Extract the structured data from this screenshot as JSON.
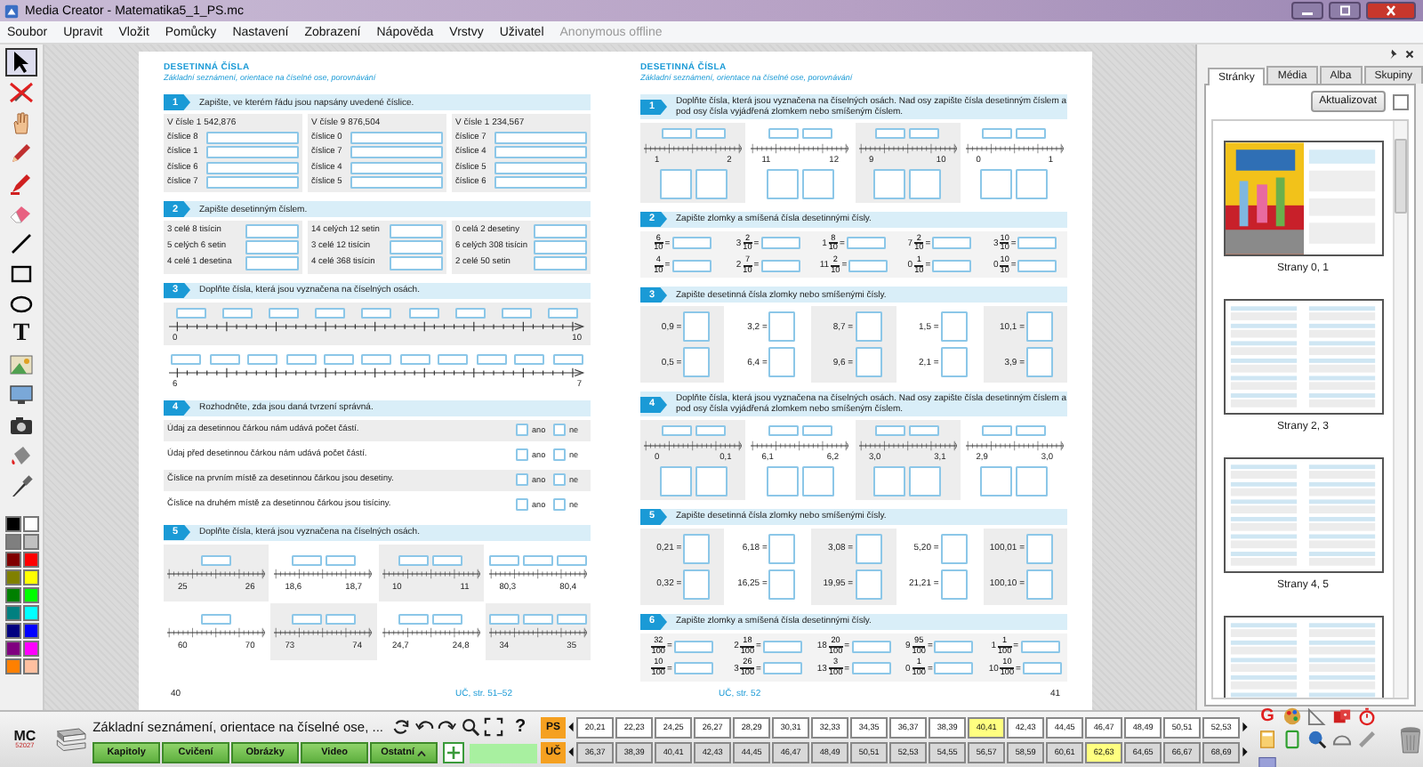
{
  "window": {
    "title": "Media Creator - Matematika5_1_PS.mc"
  },
  "menu": {
    "items": [
      "Soubor",
      "Upravit",
      "Vložit",
      "Pomůcky",
      "Nastavení",
      "Zobrazení",
      "Nápověda",
      "Vrstvy",
      "Uživatel"
    ],
    "user_status": "Anonymous offline"
  },
  "toolbar": {
    "text_tool": "T"
  },
  "pages": [
    {
      "section": "DESETINNÁ ČÍSLA",
      "subtitle": "Základní seznámení, orientace na číselné ose, porovnávání",
      "exercises": [
        {
          "number": "1",
          "kind": "digits",
          "instruction": "Zapište, ve kterém řádu jsou napsány uvedené číslice.",
          "columns": [
            {
              "heading": "V čísle 1 542,876",
              "labels": [
                "číslice 8",
                "číslice 1",
                "číslice 6",
                "číslice 7"
              ]
            },
            {
              "heading": "V čísle 9 876,504",
              "labels": [
                "číslice 0",
                "číslice 7",
                "číslice 4",
                "číslice 5"
              ]
            },
            {
              "heading": "V čísle 1 234,567",
              "labels": [
                "číslice 7",
                "číslice 4",
                "číslice 5",
                "číslice 6"
              ]
            }
          ]
        },
        {
          "number": "2",
          "kind": "words",
          "instruction": "Zapište desetinným číslem.",
          "columns": [
            [
              "3 celé 8 tisícin",
              "5 celých 6 setin",
              "4 celé 1 desetina"
            ],
            [
              "14 celých 12 setin",
              "3 celé 12 tisícin",
              "4 celé 368 tisícin"
            ],
            [
              "0 celá 2 desetiny",
              "6 celých 308 tisícin",
              "2 celé 50 setin"
            ]
          ]
        },
        {
          "number": "3",
          "kind": "axis",
          "instruction": "Doplňte čísla, která jsou vyznačena na číselných osách.",
          "axes": [
            {
              "start": "0",
              "end": "10"
            },
            {
              "start": "6",
              "end": "7"
            }
          ]
        },
        {
          "number": "4",
          "kind": "statements",
          "instruction": "Rozhodněte, zda jsou daná tvrzení správná.",
          "rows": [
            {
              "text": "Údaj za desetinnou čárkou nám udává počet částí.",
              "yes": "ano",
              "yes_checked": false,
              "no": "ne",
              "no_checked": false
            },
            {
              "text": "Údaj před desetinnou čárkou nám udává počet částí.",
              "yes": "ano",
              "yes_checked": false,
              "no": "ne",
              "no_checked": false
            },
            {
              "text": "Číslice na prvním místě za desetinnou čárkou jsou desetiny.",
              "yes": "ano",
              "yes_checked": false,
              "no": "ne",
              "no_checked": false
            },
            {
              "text": "Číslice na druhém místě za desetinnou čárkou jsou tisíciny.",
              "yes": "ano",
              "yes_checked": false,
              "no": "ne",
              "no_checked": false
            }
          ]
        },
        {
          "number": "5",
          "kind": "mini_axes",
          "instruction": "Doplňte čísla, která jsou vyznačena na číselných osách.",
          "items": [
            [
              "25",
              "26"
            ],
            [
              "18,6",
              "18,7"
            ],
            [
              "10",
              "11"
            ],
            [
              "80,3",
              "80,4"
            ],
            [
              "60",
              "70"
            ],
            [
              "73",
              "74"
            ],
            [
              "24,7",
              "24,8"
            ],
            [
              "34",
              "35"
            ]
          ]
        }
      ],
      "footer": {
        "page_number": "40",
        "reference": "UČ, str. 51–52"
      }
    },
    {
      "section": "DESETINNÁ ČÍSLA",
      "subtitle": "Základní seznámení, orientace na číselné ose, porovnávání",
      "exercises": [
        {
          "number": "1",
          "kind": "axes_fraction",
          "instruction": "Doplňte čísla, která jsou vyznačena na číselných osách. Nad osy zapište čísla desetinným číslem a pod osy čísla vyjádřená zlomkem nebo smíšeným číslem.",
          "items": [
            [
              "1",
              "2"
            ],
            [
              "11",
              "12"
            ],
            [
              "9",
              "10"
            ],
            [
              "0",
              "1"
            ]
          ]
        },
        {
          "number": "2",
          "kind": "fractions",
          "instruction": "Zapište zlomky a smíšená čísla desetinnými čísly.",
          "items": [
            {
              "num": "6",
              "den": "10",
              "sign": "="
            },
            {
              "whole": "3",
              "num": "2",
              "den": "10",
              "sign": "="
            },
            {
              "whole": "1",
              "num": "8",
              "den": "10",
              "sign": "="
            },
            {
              "whole": "7",
              "num": "2",
              "den": "10",
              "sign": "="
            },
            {
              "whole": "3",
              "num": "10",
              "den": "10",
              "sign": "="
            },
            {
              "num": "4",
              "den": "10",
              "sign": "="
            },
            {
              "whole": "2",
              "num": "7",
              "den": "10",
              "sign": "="
            },
            {
              "whole": "11",
              "num": "2",
              "den": "10",
              "sign": "="
            },
            {
              "whole": "0",
              "num": "1",
              "den": "10",
              "sign": "="
            },
            {
              "whole": "0",
              "num": "10",
              "den": "10",
              "sign": "="
            }
          ]
        },
        {
          "number": "3",
          "kind": "decimals",
          "instruction": "Zapište desetinná čísla zlomky nebo smíšenými čísly.",
          "items": [
            "0,9 =",
            "3,2 =",
            "8,7 =",
            "1,5 =",
            "10,1 =",
            "0,5 =",
            "6,4 =",
            "9,6 =",
            "2,1 =",
            "3,9 ="
          ]
        },
        {
          "number": "4",
          "kind": "axes_fraction",
          "instruction": "Doplňte čísla, která jsou vyznačena na číselných osách. Nad osy zapište čísla desetinným číslem a pod osy čísla vyjádřená zlomkem nebo smíšeným číslem.",
          "items": [
            [
              "0",
              "0,1"
            ],
            [
              "6,1",
              "6,2"
            ],
            [
              "3,0",
              "3,1"
            ],
            [
              "2,9",
              "3,0"
            ]
          ]
        },
        {
          "number": "5",
          "kind": "decimals",
          "instruction": "Zapište desetinná čísla zlomky nebo smíšenými čísly.",
          "items": [
            "0,21 =",
            "6,18 =",
            "3,08 =",
            "5,20 =",
            "100,01 =",
            "0,32 =",
            "16,25 =",
            "19,95 =",
            "21,21 =",
            "100,10 ="
          ]
        },
        {
          "number": "6",
          "kind": "fractions",
          "instruction": "Zapište zlomky a smíšená čísla desetinnými čísly.",
          "items": [
            {
              "num": "32",
              "den": "100",
              "sign": "="
            },
            {
              "whole": "2",
              "num": "18",
              "den": "100",
              "sign": "="
            },
            {
              "whole": "18",
              "num": "20",
              "den": "100",
              "sign": "="
            },
            {
              "whole": "9",
              "num": "95",
              "den": "100",
              "sign": "="
            },
            {
              "whole": "1",
              "num": "1",
              "den": "100",
              "sign": "="
            },
            {
              "num": "10",
              "den": "100",
              "sign": "="
            },
            {
              "whole": "3",
              "num": "26",
              "den": "100",
              "sign": "="
            },
            {
              "whole": "13",
              "num": "3",
              "den": "100",
              "sign": "="
            },
            {
              "whole": "0",
              "num": "1",
              "den": "100",
              "sign": "="
            },
            {
              "whole": "10",
              "num": "10",
              "den": "100",
              "sign": "="
            }
          ]
        }
      ],
      "footer": {
        "page_number": "41",
        "reference": "UČ, str. 52"
      }
    }
  ],
  "side_panel": {
    "tabs": [
      {
        "label": "Stránky",
        "selected": true
      },
      {
        "label": "Média",
        "selected": false
      },
      {
        "label": "Alba",
        "selected": false
      },
      {
        "label": "Skupiny",
        "selected": false
      }
    ],
    "refresh_button": "Aktualizovat",
    "checkbox": {
      "checked": false
    },
    "thumbnails": [
      {
        "kind": "cover",
        "caption": "Strany 0, 1"
      },
      {
        "kind": "pages",
        "caption": "Strany 2, 3"
      },
      {
        "kind": "pages",
        "caption": "Strany 4, 5"
      },
      {
        "kind": "pages"
      }
    ]
  },
  "bottom_bar": {
    "logo": "MC",
    "version": "52027",
    "title": "Základní seznámení, orientace na číselné ose, ...",
    "help": "?",
    "buttons": [
      {
        "label": "Kapitoly"
      },
      {
        "label": "Cvičení"
      },
      {
        "label": "Obrázky"
      },
      {
        "label": "Video"
      },
      {
        "label": "Ostatní",
        "caret": true
      }
    ],
    "page_rows": [
      {
        "label": "PS",
        "pages": [
          {
            "label": "20,21",
            "selected": false
          },
          {
            "label": "22,23",
            "selected": false
          },
          {
            "label": "24,25",
            "selected": false
          },
          {
            "label": "26,27",
            "selected": false
          },
          {
            "label": "28,29",
            "selected": false
          },
          {
            "label": "30,31",
            "selected": false
          },
          {
            "label": "32,33",
            "selected": false
          },
          {
            "label": "34,35",
            "selected": false
          },
          {
            "label": "36,37",
            "selected": false
          },
          {
            "label": "38,39",
            "selected": false
          },
          {
            "label": "40,41",
            "selected": true
          },
          {
            "label": "42,43",
            "selected": false
          },
          {
            "label": "44,45",
            "selected": false
          },
          {
            "label": "46,47",
            "selected": false
          },
          {
            "label": "48,49",
            "selected": false
          },
          {
            "label": "50,51",
            "selected": false
          },
          {
            "label": "52,53",
            "selected": false
          }
        ]
      },
      {
        "label": "UČ",
        "pages": [
          {
            "label": "36,37",
            "selected": false
          },
          {
            "label": "38,39",
            "selected": false
          },
          {
            "label": "40,41",
            "selected": false
          },
          {
            "label": "42,43",
            "selected": false
          },
          {
            "label": "44,45",
            "selected": false
          },
          {
            "label": "46,47",
            "selected": false
          },
          {
            "label": "48,49",
            "selected": false
          },
          {
            "label": "50,51",
            "selected": false
          },
          {
            "label": "52,53",
            "selected": false
          },
          {
            "label": "54,55",
            "selected": false
          },
          {
            "label": "56,57",
            "selected": false
          },
          {
            "label": "58,59",
            "selected": false
          },
          {
            "label": "60,61",
            "selected": false
          },
          {
            "label": "62,63",
            "selected": true
          },
          {
            "label": "64,65",
            "selected": false
          },
          {
            "label": "66,67",
            "selected": false
          },
          {
            "label": "68,69",
            "selected": false
          }
        ]
      }
    ],
    "tool_letter": "G"
  }
}
